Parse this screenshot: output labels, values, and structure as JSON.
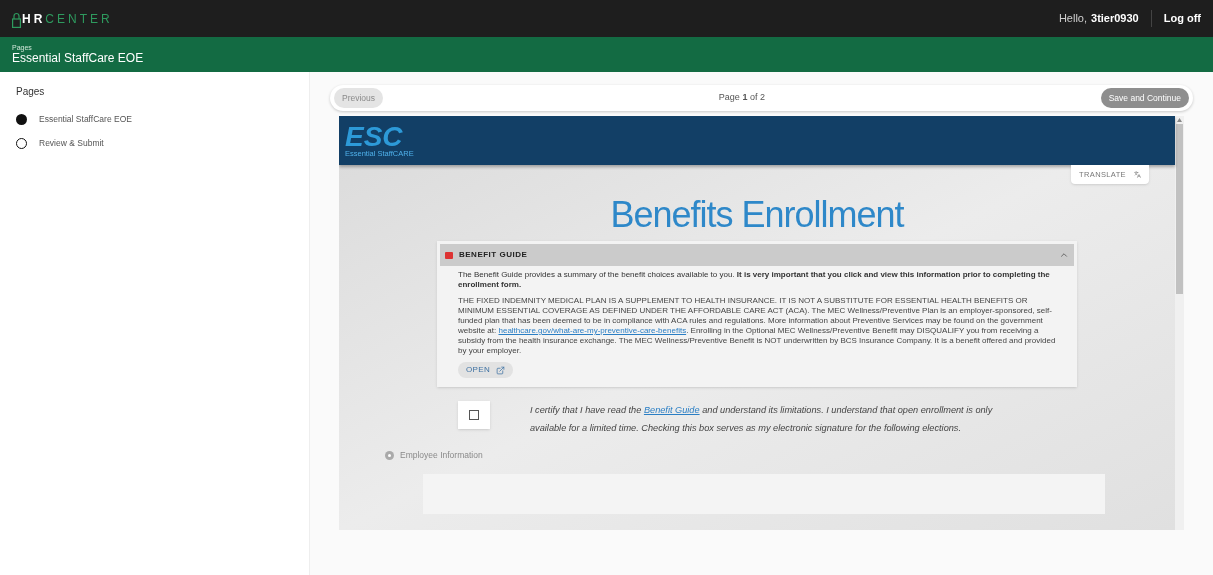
{
  "header": {
    "logo": {
      "strong": "HR",
      "accent": "CENTER"
    },
    "greeting": "Hello,",
    "username": "3tier0930",
    "logoff": "Log off"
  },
  "subheader": {
    "caption": "Pages",
    "title": "Essential StaffCare EOE"
  },
  "sidebar": {
    "heading": "Pages",
    "items": [
      {
        "label": "Essential StaffCare EOE",
        "selected": true
      },
      {
        "label": "Review & Submit",
        "selected": false
      }
    ]
  },
  "pager": {
    "previous": {
      "label": "Previous",
      "disabled": true
    },
    "indicator": "Page **1** of 2",
    "next": {
      "label": "Save and Continue",
      "disabled": false
    }
  },
  "form": {
    "brand": {
      "mark": "ESC",
      "tagline": "Essential StaffCARE"
    },
    "translate": "TRANSLATE",
    "title": "Benefits Enrollment",
    "guide": {
      "title": "BENEFIT GUIDE",
      "expanded": true,
      "intro": "The Benefit Guide provides a summary of the benefit choices available to you. **It is very important that you click and view this information prior to completing the enrollment form.**",
      "notice_before": "THE FIXED INDEMNITY MEDICAL PLAN IS A SUPPLEMENT TO HEALTH INSURANCE. IT IS NOT A SUBSTITUTE FOR ESSENTIAL HEALTH BENEFITS OR MINIMUM ESSENTIAL COVERAGE AS DEFINED UNDER THE AFFORDABLE CARE ACT (ACA). The MEC Wellness/Preventive Plan is an employer-sponsored, self-funded plan that has been deemed to be in compliance with ACA rules and regulations. More information about Preventive Services may be found on the government website at:",
      "notice_link": "healthcare.gov/what-are-my-preventive-care-benefits",
      "notice_after": ". Enrolling in the Optional MEC Wellness/Preventive Benefit may DISQUALIFY you from receiving a subsidy from the health insurance exchange. The MEC Wellness/Preventive Benefit is NOT underwritten by BCS Insurance Company. It is a benefit offered and provided by your employer.",
      "open": "OPEN"
    },
    "certify": {
      "checked": false,
      "before": "I certify that I have read the",
      "link": "Benefit Guide",
      "after": "and understand its limitations. I understand that open enrollment is only available for a limited time. Checking this box serves as my electronic signature for the following elections."
    },
    "section": {
      "label": "Employee Information"
    }
  }
}
